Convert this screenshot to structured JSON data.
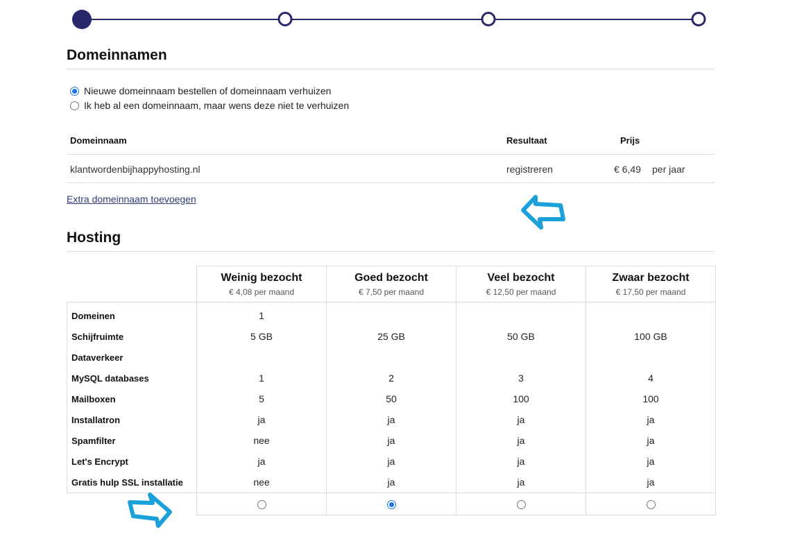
{
  "progress": {
    "steps": 4,
    "active_step": 1
  },
  "domains": {
    "title": "Domeinnamen",
    "options": [
      {
        "label": "Nieuwe domeinnaam bestellen of domeinnaam verhuizen",
        "checked": true
      },
      {
        "label": "Ik heb al een domeinnaam, maar wens deze niet te verhuizen",
        "checked": false
      }
    ],
    "headers": {
      "domain": "Domeinnaam",
      "result": "Resultaat",
      "price": "Prijs"
    },
    "rows": [
      {
        "domain": "klantwordenbijhappyhosting.nl",
        "result": "registreren",
        "price": "€ 6,49",
        "period": "per jaar"
      }
    ],
    "add_link": "Extra domeinnaam toevoegen"
  },
  "hosting": {
    "title": "Hosting",
    "plans": [
      {
        "name": "Weinig bezocht",
        "price": "€ 4,08 per maand",
        "selected": false
      },
      {
        "name": "Goed bezocht",
        "price": "€ 7,50 per maand",
        "selected": true
      },
      {
        "name": "Veel bezocht",
        "price": "€ 12,50 per maand",
        "selected": false
      },
      {
        "name": "Zwaar bezocht",
        "price": "€ 17,50 per maand",
        "selected": false
      }
    ],
    "features": [
      {
        "label": "Domeinen",
        "values": [
          "1",
          "",
          "",
          ""
        ]
      },
      {
        "label": "Schijfruimte",
        "values": [
          "5 GB",
          "25 GB",
          "50 GB",
          "100 GB"
        ]
      },
      {
        "label": "Dataverkeer",
        "values": [
          "",
          "",
          "",
          ""
        ]
      },
      {
        "label": "MySQL databases",
        "values": [
          "1",
          "2",
          "3",
          "4"
        ]
      },
      {
        "label": "Mailboxen",
        "values": [
          "5",
          "50",
          "100",
          "100"
        ]
      },
      {
        "label": "Installatron",
        "values": [
          "ja",
          "ja",
          "ja",
          "ja"
        ]
      },
      {
        "label": "Spamfilter",
        "values": [
          "nee",
          "ja",
          "ja",
          "ja"
        ]
      },
      {
        "label": "Let's Encrypt",
        "values": [
          "ja",
          "ja",
          "ja",
          "ja"
        ]
      },
      {
        "label": "Gratis hulp SSL installatie",
        "values": [
          "nee",
          "ja",
          "ja",
          "ja"
        ]
      }
    ]
  },
  "colors": {
    "accent": "#27286b",
    "radio": "#1a73e8",
    "annotation_arrow": "#1ba1d9",
    "link": "#2c3a7a"
  }
}
